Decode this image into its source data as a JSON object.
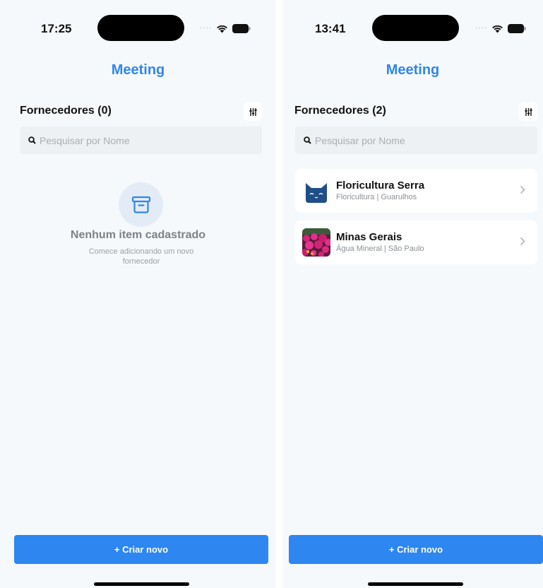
{
  "left_screen": {
    "status": {
      "time": "17:25"
    },
    "nav_title": "Meeting",
    "section_title": "Fornecedores (0)",
    "search": {
      "placeholder": "Pesquisar por Nome",
      "value": ""
    },
    "empty_state": {
      "icon": "archive-box-icon",
      "title": "Nenhum item cadastrado",
      "subtitle": "Comece adicionando um novo fornecedor"
    },
    "cta_label": "+ Criar novo"
  },
  "right_screen": {
    "status": {
      "time": "13:41"
    },
    "nav_title": "Meeting",
    "section_title": "Fornecedores (2)",
    "search": {
      "placeholder": "Pesquisar por Nome",
      "value": ""
    },
    "suppliers": [
      {
        "name": "Floricultura Serra",
        "subtitle": "Floricultura | Guarulhos",
        "avatar": "cat-face-avatar"
      },
      {
        "name": "Minas Gerais",
        "subtitle": "Água Mineral | São Paulo",
        "avatar": "flower-photo-avatar"
      }
    ],
    "cta_label": "+ Criar novo"
  },
  "colors": {
    "accent": "#2f86ee",
    "background": "#f6f9fb",
    "search_bg": "#eef1f3",
    "empty_icon_bg": "#e3ecf6"
  }
}
